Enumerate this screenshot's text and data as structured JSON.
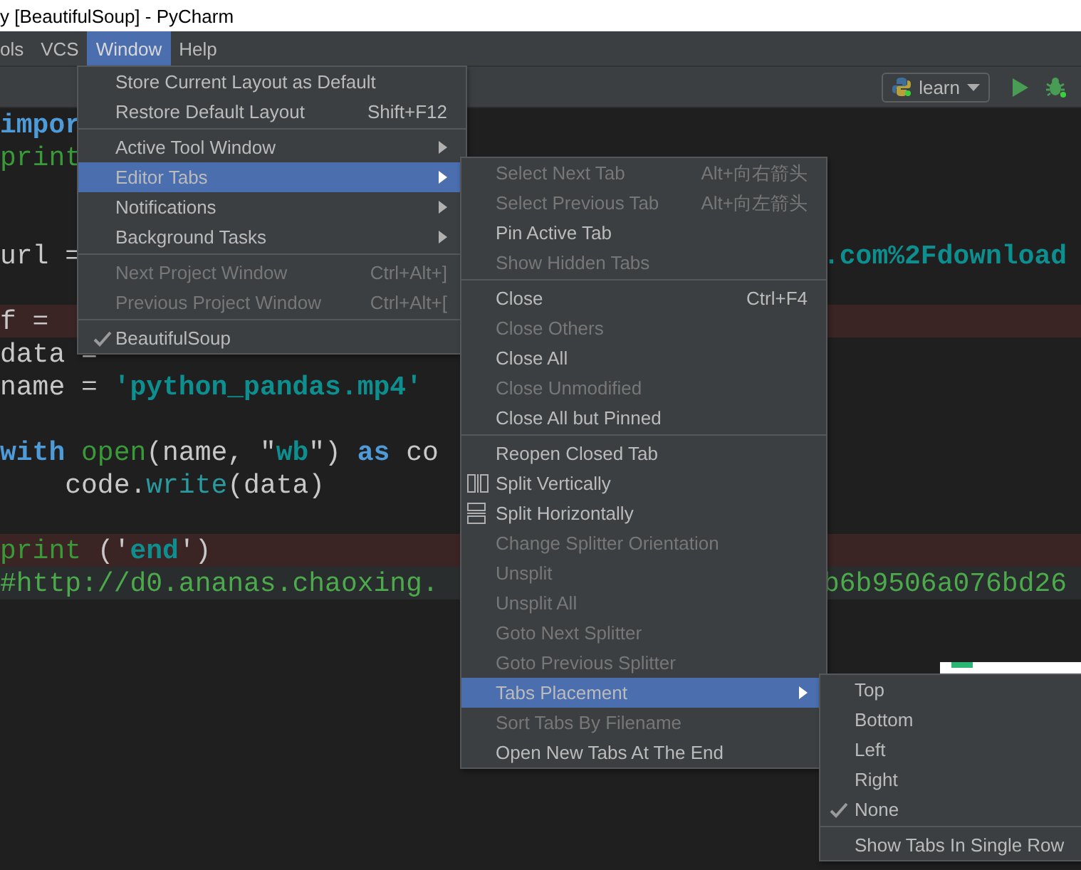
{
  "window": {
    "title": "y [BeautifulSoup] - PyCharm"
  },
  "menu_bar": [
    {
      "label": "ols",
      "selected": false
    },
    {
      "label": "VCS",
      "selected": false
    },
    {
      "label": "Window",
      "selected": true
    },
    {
      "label": "Help",
      "selected": false
    }
  ],
  "toolbar": {
    "run_configuration": "learn"
  },
  "editor": {
    "lines": [
      {
        "breakpoint": false,
        "tokens": [
          {
            "text": "impor",
            "kind": "keyword"
          }
        ]
      },
      {
        "breakpoint": false,
        "tokens": [
          {
            "text": "print",
            "kind": "builtin"
          }
        ]
      },
      {
        "breakpoint": false
      },
      {
        "breakpoint": false
      },
      {
        "breakpoint": false,
        "tokens": [
          {
            "text": "url =",
            "kind": "plain"
          }
        ],
        "tail": [
          {
            "text": ".com%2Fdownload",
            "kind": "string"
          }
        ]
      },
      {
        "breakpoint": false
      },
      {
        "breakpoint": true,
        "tokens": [
          {
            "text": "f =",
            "kind": "plain"
          }
        ]
      },
      {
        "breakpoint": false,
        "tokens": [
          {
            "text": "data =",
            "kind": "plain"
          }
        ]
      },
      {
        "breakpoint": false,
        "tokens": [
          {
            "text": "name = ",
            "kind": "plain"
          },
          {
            "text": "'python_pandas.mp4'",
            "kind": "string"
          }
        ]
      },
      {
        "breakpoint": false
      },
      {
        "breakpoint": false,
        "tokens": [
          {
            "text": "with",
            "kind": "keyword"
          },
          {
            "text": " open",
            "kind": "builtin"
          },
          {
            "text": "(name, \"",
            "kind": "plain"
          },
          {
            "text": "wb",
            "kind": "string"
          },
          {
            "text": "\") ",
            "kind": "plain"
          },
          {
            "text": "as",
            "kind": "keyword"
          },
          {
            "text": " co",
            "kind": "plain"
          }
        ]
      },
      {
        "breakpoint": false,
        "tokens": [
          {
            "text": "    code.",
            "kind": "plain"
          },
          {
            "text": "write",
            "kind": "method"
          },
          {
            "text": "(data)",
            "kind": "plain"
          }
        ]
      },
      {
        "breakpoint": false
      },
      {
        "breakpoint": true,
        "tokens": [
          {
            "text": "print",
            "kind": "builtin"
          },
          {
            "text": " ('",
            "kind": "plain"
          },
          {
            "text": "end",
            "kind": "string"
          },
          {
            "text": "')",
            "kind": "plain"
          }
        ]
      },
      {
        "breakpoint": false,
        "current": true,
        "tokens": [
          {
            "text": "#http://d0.ananas.chaoxing.",
            "kind": "comment"
          }
        ],
        "tail": [
          {
            "text": "b6b9506a076bd26",
            "kind": "comment"
          }
        ]
      }
    ]
  },
  "window_menu": {
    "groups": [
      [
        {
          "label": "Store Current Layout as Default",
          "disabled": false,
          "selected": false,
          "submenu": false,
          "checked": false
        },
        {
          "label": "Restore Default Layout",
          "shortcut": "Shift+F12",
          "disabled": false,
          "selected": false,
          "submenu": false,
          "checked": false
        }
      ],
      [
        {
          "label": "Active Tool Window",
          "disabled": false,
          "selected": false,
          "submenu": true,
          "checked": false
        },
        {
          "label": "Editor Tabs",
          "disabled": false,
          "selected": true,
          "submenu": true,
          "checked": false
        },
        {
          "label": "Notifications",
          "disabled": false,
          "selected": false,
          "submenu": true,
          "checked": false
        },
        {
          "label": "Background Tasks",
          "disabled": false,
          "selected": false,
          "submenu": true,
          "checked": false
        }
      ],
      [
        {
          "label": "Next Project Window",
          "shortcut": "Ctrl+Alt+]",
          "disabled": true,
          "selected": false,
          "submenu": false,
          "checked": false
        },
        {
          "label": "Previous Project Window",
          "shortcut": "Ctrl+Alt+[",
          "disabled": true,
          "selected": false,
          "submenu": false,
          "checked": false
        }
      ],
      [
        {
          "label": "BeautifulSoup",
          "disabled": false,
          "selected": false,
          "submenu": false,
          "checked": true
        }
      ]
    ]
  },
  "editor_tabs_menu": {
    "groups": [
      [
        {
          "label": "Select Next Tab",
          "shortcut": "Alt+向右箭头",
          "kind": "item",
          "disabled": true,
          "selected": false,
          "submenu": false
        },
        {
          "label": "Select Previous Tab",
          "shortcut": "Alt+向左箭头",
          "kind": "item",
          "disabled": true,
          "selected": false,
          "submenu": false
        },
        {
          "label": "Pin Active Tab",
          "kind": "item",
          "disabled": false,
          "selected": false,
          "submenu": false
        },
        {
          "label": "Show Hidden Tabs",
          "kind": "item",
          "disabled": true,
          "selected": false,
          "submenu": false
        }
      ],
      [
        {
          "label": "Close",
          "shortcut": "Ctrl+F4",
          "kind": "item",
          "disabled": false,
          "selected": false,
          "submenu": false
        },
        {
          "label": "Close Others",
          "kind": "item",
          "disabled": true,
          "selected": false,
          "submenu": false
        },
        {
          "label": "Close All",
          "kind": "item",
          "disabled": false,
          "selected": false,
          "submenu": false
        },
        {
          "label": "Close Unmodified",
          "kind": "item",
          "disabled": true,
          "selected": false,
          "submenu": false
        },
        {
          "label": "Close All but Pinned",
          "kind": "item",
          "disabled": false,
          "selected": false,
          "submenu": false
        }
      ],
      [
        {
          "label": "Reopen Closed Tab",
          "kind": "item",
          "disabled": false,
          "selected": false,
          "submenu": false
        },
        {
          "label": "Split Vertically",
          "kind": "split-v",
          "disabled": false,
          "selected": false,
          "submenu": false
        },
        {
          "label": "Split Horizontally",
          "kind": "split-h",
          "disabled": false,
          "selected": false,
          "submenu": false
        },
        {
          "label": "Change Splitter Orientation",
          "kind": "item",
          "disabled": true,
          "selected": false,
          "submenu": false
        },
        {
          "label": "Unsplit",
          "kind": "item",
          "disabled": true,
          "selected": false,
          "submenu": false
        },
        {
          "label": "Unsplit All",
          "kind": "item",
          "disabled": true,
          "selected": false,
          "submenu": false
        },
        {
          "label": "Goto Next Splitter",
          "kind": "item",
          "disabled": true,
          "selected": false,
          "submenu": false
        },
        {
          "label": "Goto Previous Splitter",
          "kind": "item",
          "disabled": true,
          "selected": false,
          "submenu": false
        },
        {
          "label": "Tabs Placement",
          "kind": "item",
          "disabled": false,
          "selected": true,
          "submenu": true
        },
        {
          "label": "Sort Tabs By Filename",
          "kind": "item",
          "disabled": true,
          "selected": false,
          "submenu": false
        },
        {
          "label": "Open New Tabs At The End",
          "kind": "item",
          "disabled": false,
          "selected": false,
          "submenu": false
        }
      ]
    ]
  },
  "tabs_placement_menu": {
    "groups": [
      [
        {
          "label": "Top",
          "checked": false,
          "selected": false
        },
        {
          "label": "Bottom",
          "checked": false,
          "selected": false
        },
        {
          "label": "Left",
          "checked": false,
          "selected": false
        },
        {
          "label": "Right",
          "checked": false,
          "selected": false
        },
        {
          "label": "None",
          "checked": true,
          "selected": false
        }
      ],
      [
        {
          "label": "Show Tabs In Single Row",
          "checked": false,
          "selected": false
        }
      ]
    ]
  }
}
